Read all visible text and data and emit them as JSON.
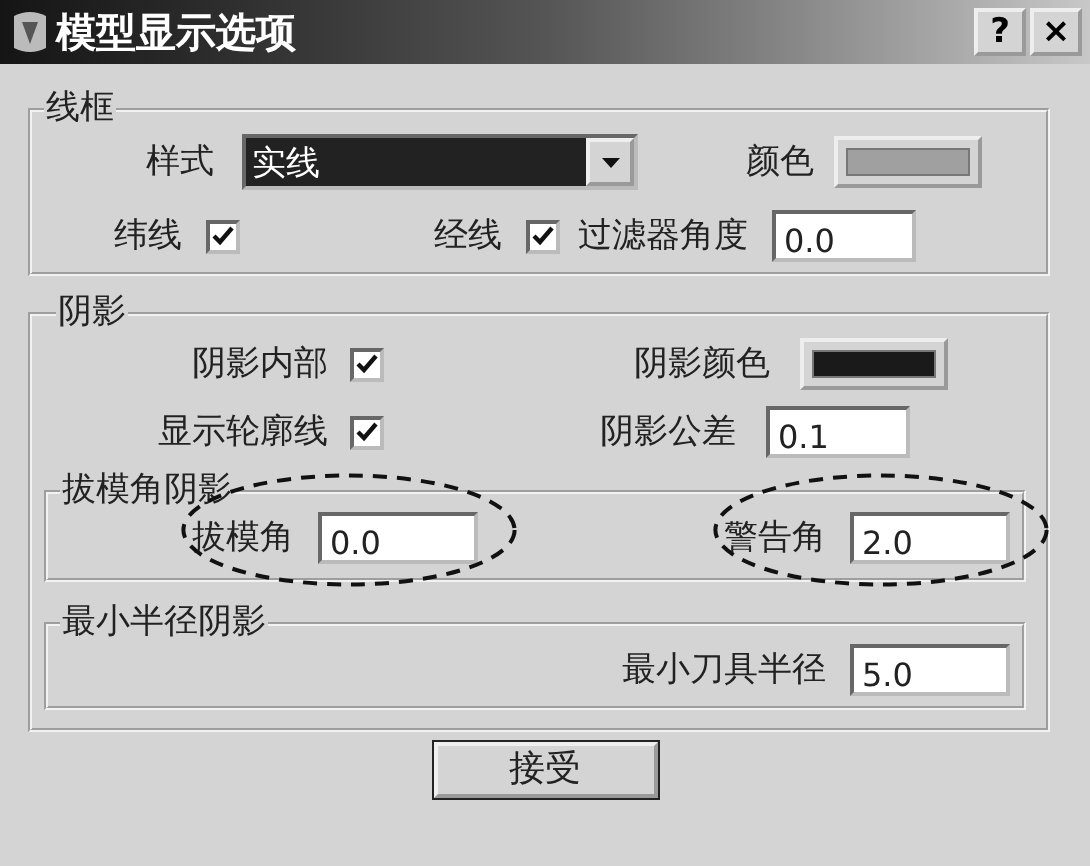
{
  "window": {
    "title": "模型显示选项",
    "buttons": [
      "?",
      "×"
    ]
  },
  "wireframe": {
    "title": "线框",
    "style": {
      "label": "样式",
      "value": "实线"
    },
    "color": {
      "label": "颜色",
      "color": "#a0a0a0"
    },
    "checks": [
      {
        "label": "纬线",
        "checked": true
      },
      {
        "label": "经线",
        "checked": true
      }
    ],
    "filter_angle": {
      "label": "过滤器角度",
      "value": "0.0"
    }
  },
  "shading": {
    "title": "阴影",
    "checks": [
      {
        "label": "阴影内部",
        "checked": true
      },
      {
        "label": "显示轮廓线",
        "checked": true
      }
    ],
    "color": {
      "label": "阴影颜色",
      "color": "#1a1a1a"
    },
    "tolerance": {
      "label": "阴影公差",
      "value": "0.1"
    },
    "draft": {
      "title": "拔模角阴影",
      "fields": [
        {
          "label": "拔模角",
          "value": "0.0",
          "circled": true
        },
        {
          "label": "警告角",
          "value": "2.0",
          "circled": true
        }
      ]
    },
    "min_radius": {
      "title": "最小半径阴影",
      "fields": [
        {
          "label": "最小刀具半径",
          "value": "5.0",
          "circled": false
        }
      ]
    }
  },
  "buttons": [
    "接受"
  ]
}
